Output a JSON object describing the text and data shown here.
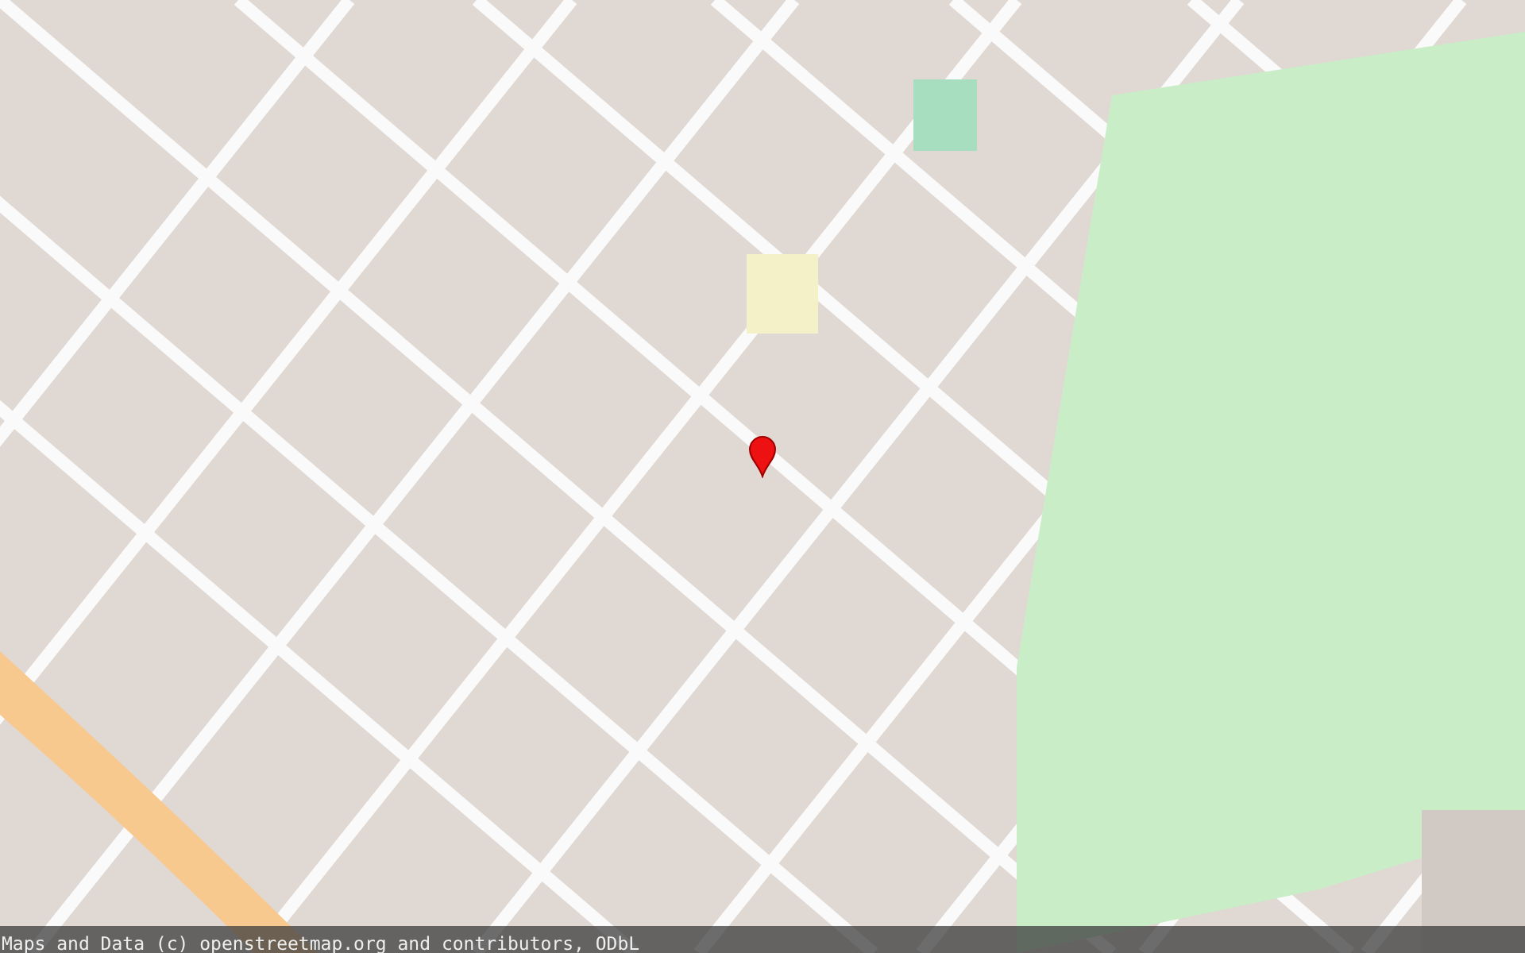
{
  "map": {
    "attribution": "Maps and Data (c) openstreetmap.org and contributors, ODbL"
  }
}
